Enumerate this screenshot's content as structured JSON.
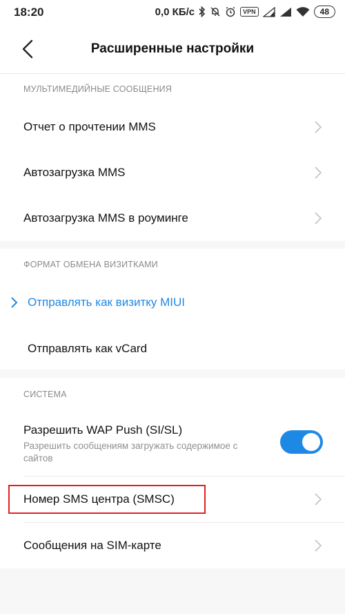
{
  "status_bar": {
    "time": "18:20",
    "network_speed": "0,0 КБ/с",
    "vpn": "VPN",
    "battery": "48",
    "icons": [
      "bluetooth-icon",
      "mute-icon",
      "alarm-icon",
      "vpn-icon",
      "signal-icon",
      "signal-icon",
      "wifi-icon",
      "battery-icon"
    ]
  },
  "header": {
    "title": "Расширенные настройки",
    "back_icon": "back-arrow-icon"
  },
  "sections": {
    "mms": {
      "header": "МУЛЬТИМЕДИЙНЫЕ СООБЩЕНИЯ",
      "items": [
        {
          "label": "Отчет о прочтении MMS"
        },
        {
          "label": "Автозагрузка MMS"
        },
        {
          "label": "Автозагрузка MMS в роуминге"
        }
      ]
    },
    "vcard": {
      "header": "ФОРМАТ ОБМЕНА ВИЗИТКАМИ",
      "items": [
        {
          "label": "Отправлять как визитку MIUI",
          "selected": true
        },
        {
          "label": "Отправлять как vCard",
          "selected": false
        }
      ]
    },
    "system": {
      "header": "СИСТЕМА",
      "wap_push": {
        "label": "Разрешить WAP Push (SI/SL)",
        "sublabel": "Разрешить сообщениям загружать содержимое с сайтов",
        "enabled": true
      },
      "items": [
        {
          "label": "Номер SMS центра (SMSC)"
        },
        {
          "label": "Сообщения на SIM-карте"
        }
      ]
    }
  },
  "colors": {
    "accent": "#1e88e5",
    "highlight": "#e02020",
    "background": "#f7f7f7"
  }
}
